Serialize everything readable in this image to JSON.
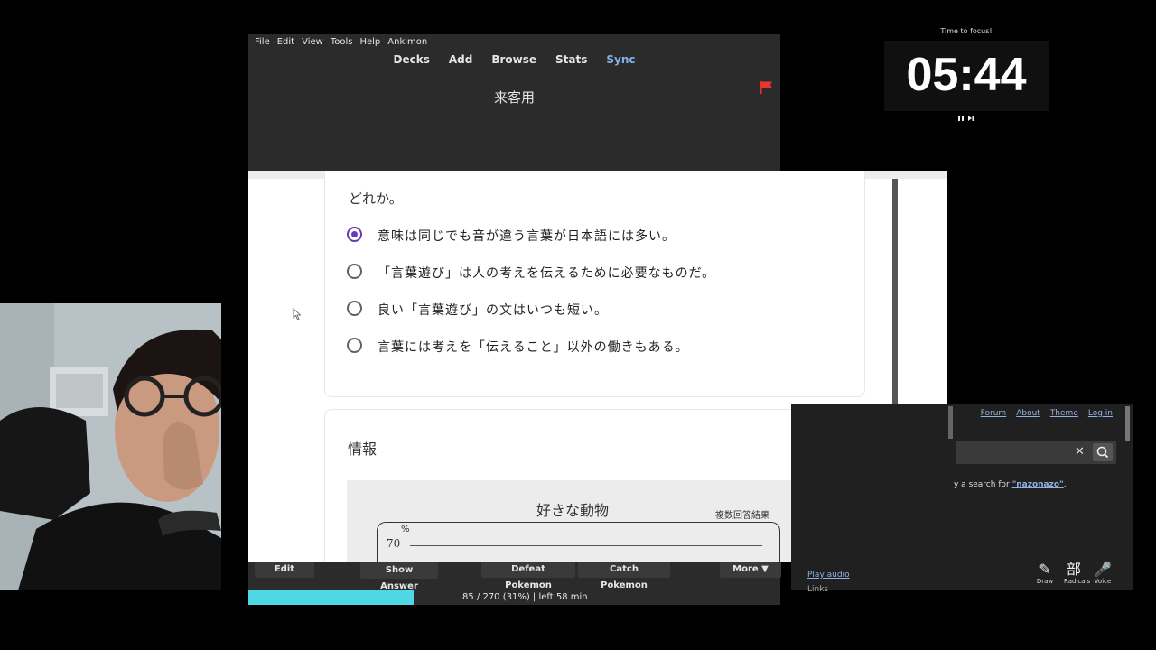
{
  "anki": {
    "menu": [
      "File",
      "Edit",
      "View",
      "Tools",
      "Help",
      "Ankimon"
    ],
    "nav": [
      "Decks",
      "Add",
      "Browse",
      "Stats",
      "Sync"
    ],
    "deck_title": "来客用",
    "buttons": {
      "edit": "Edit",
      "show_answer": "Show Answer",
      "defeat": "Defeat Pokemon",
      "catch": "Catch Pokemon",
      "more": "More ▼"
    },
    "progress_text": "85 / 270 (31%) | left 58 min",
    "progress_fraction": 0.31
  },
  "card": {
    "question_tail": "どれか。",
    "options": [
      {
        "text": "意味は同じでも音が違う言葉が日本語には多い。",
        "selected": true
      },
      {
        "text": "「言葉遊び」は人の考えを伝えるために必要なものだ。",
        "selected": false
      },
      {
        "text": "良い「言葉遊び」の文はいつも短い。",
        "selected": false
      },
      {
        "text": "言葉には考えを「伝えること」以外の働きもある。",
        "selected": false
      }
    ],
    "info_title": "情報",
    "figure": {
      "title": "好きな動物",
      "subtitle": "複数回答結果",
      "percent_sign": "%",
      "tick": "70"
    }
  },
  "timer": {
    "label": "Time to focus!",
    "value": "05:44"
  },
  "jisho": {
    "nav": [
      "Forum",
      "About",
      "Theme",
      "Log in"
    ],
    "clear": "✕",
    "message_prefix": "y a search for ",
    "message_term": "\"nazonazo\"",
    "message_suffix": ".",
    "play_audio": "Play audio",
    "links": "Links",
    "tools": [
      {
        "glyph": "✎",
        "label": "Draw"
      },
      {
        "glyph": "部",
        "label": "Radicals"
      },
      {
        "glyph": "🎤",
        "label": "Voice"
      }
    ]
  },
  "colors": {
    "accent_purple": "#673ab7",
    "scroll_top_red": "#e21b3c",
    "progress_cyan": "#4fd7e6",
    "sync_blue": "#7fb0e8"
  }
}
